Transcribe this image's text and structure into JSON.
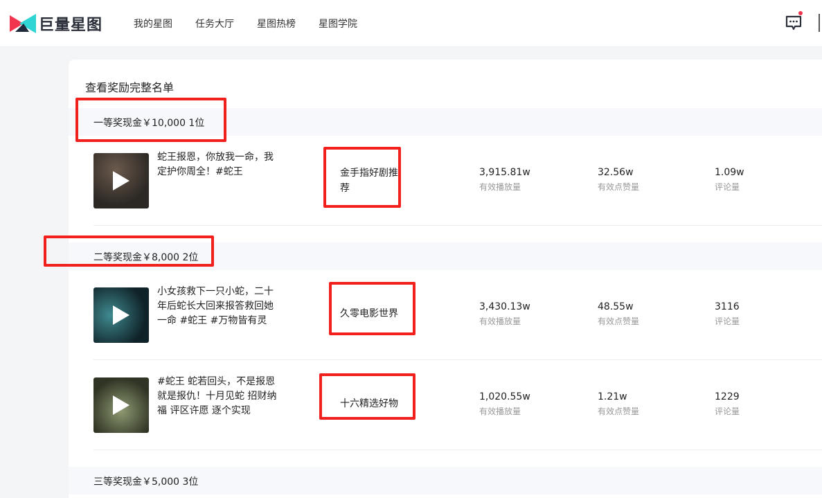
{
  "app": {
    "name": "巨量星图",
    "accent": "#f1201c"
  },
  "nav": {
    "items": [
      "我的星图",
      "任务大厅",
      "星图热榜",
      "星图学院"
    ]
  },
  "page": {
    "title": "查看奖励完整名单"
  },
  "tiers": [
    {
      "label": "一等奖现金￥10,000  1位"
    },
    {
      "label": "二等奖现金￥8,000  2位"
    },
    {
      "label": "三等奖现金￥5,000  3位"
    }
  ],
  "videos": [
    {
      "title": "蛇王报恩，你放我一命，我定护你周全！#蛇王",
      "author": "金手指好剧推荐",
      "plays": "3,915.81w",
      "plays_label": "有效播放量",
      "likes": "32.56w",
      "likes_label": "有效点赞量",
      "comments": "1.09w",
      "comments_label": "评论量"
    },
    {
      "title": "小女孩救下一只小蛇，二十年后蛇长大回来报答救回她一命 #蛇王 #万物皆有灵",
      "author": "久零电影世界",
      "plays": "3,430.13w",
      "plays_label": "有效播放量",
      "likes": "48.55w",
      "likes_label": "有效点赞量",
      "comments": "3116",
      "comments_label": "评论量"
    },
    {
      "title": "#蛇王 蛇若回头，不是报恩就是报仇！十月见蛇 招财纳福 评区许愿 逐个实现",
      "author": "十六精选好物",
      "plays": "1,020.55w",
      "plays_label": "有效播放量",
      "likes": "1.21w",
      "likes_label": "有效点赞量",
      "comments": "1229",
      "comments_label": "评论量"
    }
  ]
}
